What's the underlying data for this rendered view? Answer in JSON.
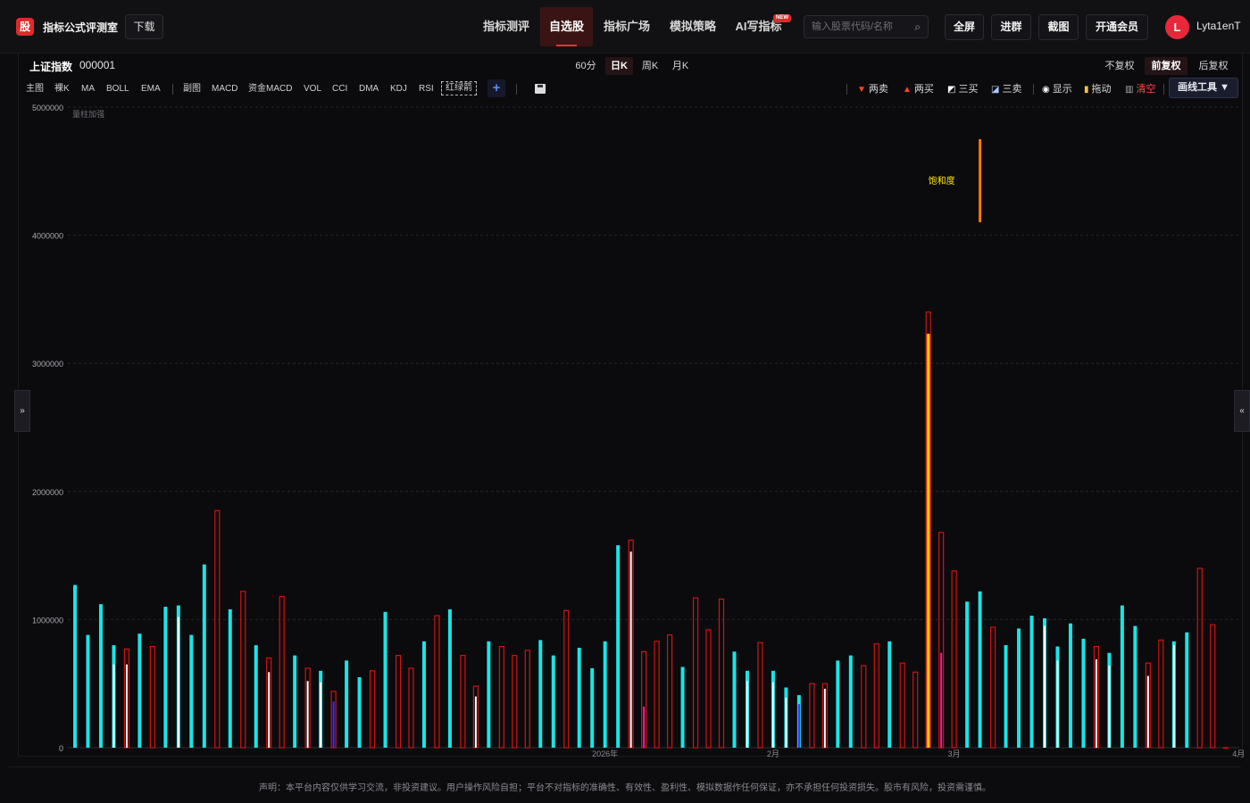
{
  "header": {
    "logo_char": "股",
    "app_title": "指标公式评测室",
    "download": "下载",
    "nav": [
      "指标测评",
      "自选股",
      "指标广场",
      "模拟策略",
      "AI写指标"
    ],
    "nav_active": 1,
    "new_badge": "NEW",
    "search_placeholder": "输入股票代码/名称",
    "search_icon": "⌕",
    "buttons": [
      "全屏",
      "进群",
      "截图",
      "开通会员"
    ],
    "avatar_letter": "L",
    "username": "Lyta1enT"
  },
  "stock": {
    "name": "上证指数",
    "code": "000001"
  },
  "periods": {
    "items": [
      "60分",
      "日K",
      "周K",
      "月K"
    ],
    "active": 1
  },
  "adjust": {
    "items": [
      "不复权",
      "前复权",
      "后复权"
    ],
    "active": 1
  },
  "indicators": {
    "main": [
      "主图",
      "裸K",
      "MA",
      "BOLL",
      "EMA"
    ],
    "sub": [
      "副图",
      "MACD",
      "资金MACD",
      "VOL",
      "CCI",
      "DMA",
      "KDJ",
      "RSI",
      "红绿箭"
    ],
    "add": "+"
  },
  "tools": {
    "two_sell": "两卖",
    "two_buy": "两买",
    "three_buy": "三买",
    "three_sell": "三卖",
    "show": "显示",
    "drag": "拖动",
    "clear": "清空",
    "draw_tool": "画线工具 ▼"
  },
  "side": {
    "left": "»",
    "right": "«"
  },
  "footer": "声明：本平台内容仅供学习交流，非投资建议。用户操作风险自担；平台不对指标的准确性、有效性、盈利性、模拟数据作任何保证，亦不承担任何投资损失。股市有风险，投资需谨慎。",
  "colors": {
    "accent": "#e33",
    "cyan": "#18e6e6",
    "red": "#d71010",
    "orange": "#ff7a00",
    "yellow": "#ffd400",
    "pink": "#ff1a9a"
  },
  "chart_data": {
    "type": "bar",
    "series_label": "量柱加强",
    "annotation": "饱和度",
    "ylim": [
      0,
      5000000
    ],
    "yticks": [
      0,
      1000000,
      2000000,
      3000000,
      4000000,
      5000000
    ],
    "xlabels": [
      "2026年",
      "2月",
      "3月",
      "4月"
    ],
    "xlabel_index": [
      41,
      54,
      68,
      90
    ],
    "bars": [
      {
        "v": 1270000,
        "c": "cyan"
      },
      {
        "v": 880000,
        "c": "cyan"
      },
      {
        "v": 1120000,
        "c": "cyan"
      },
      {
        "v": 800000,
        "c": "cyan",
        "in": 650000,
        "ic": "white"
      },
      {
        "v": 770000,
        "c": "red",
        "in": 650000,
        "ic": "white"
      },
      {
        "v": 890000,
        "c": "cyan"
      },
      {
        "v": 790000,
        "c": "red"
      },
      {
        "v": 1100000,
        "c": "cyan"
      },
      {
        "v": 1110000,
        "c": "cyan",
        "in": 1020000,
        "ic": "white"
      },
      {
        "v": 880000,
        "c": "cyan"
      },
      {
        "v": 1430000,
        "c": "cyan"
      },
      {
        "v": 1850000,
        "c": "red"
      },
      {
        "v": 1080000,
        "c": "cyan"
      },
      {
        "v": 1220000,
        "c": "red"
      },
      {
        "v": 800000,
        "c": "cyan"
      },
      {
        "v": 700000,
        "c": "red",
        "in": 590000,
        "ic": "white"
      },
      {
        "v": 1180000,
        "c": "red"
      },
      {
        "v": 720000,
        "c": "cyan"
      },
      {
        "v": 620000,
        "c": "red",
        "in": 520000,
        "ic": "white"
      },
      {
        "v": 600000,
        "c": "cyan",
        "in": 510000,
        "ic": "white"
      },
      {
        "v": 440000,
        "c": "red",
        "in": 360000,
        "ic": "blue"
      },
      {
        "v": 680000,
        "c": "cyan"
      },
      {
        "v": 550000,
        "c": "cyan"
      },
      {
        "v": 600000,
        "c": "red"
      },
      {
        "v": 1060000,
        "c": "cyan"
      },
      {
        "v": 720000,
        "c": "red"
      },
      {
        "v": 620000,
        "c": "red"
      },
      {
        "v": 830000,
        "c": "cyan"
      },
      {
        "v": 1030000,
        "c": "red"
      },
      {
        "v": 1080000,
        "c": "cyan"
      },
      {
        "v": 720000,
        "c": "red"
      },
      {
        "v": 480000,
        "c": "red",
        "in": 400000,
        "ic": "white"
      },
      {
        "v": 830000,
        "c": "cyan"
      },
      {
        "v": 790000,
        "c": "red"
      },
      {
        "v": 720000,
        "c": "red"
      },
      {
        "v": 760000,
        "c": "red"
      },
      {
        "v": 840000,
        "c": "cyan"
      },
      {
        "v": 720000,
        "c": "cyan"
      },
      {
        "v": 1070000,
        "c": "red"
      },
      {
        "v": 780000,
        "c": "cyan"
      },
      {
        "v": 620000,
        "c": "cyan"
      },
      {
        "v": 830000,
        "c": "cyan"
      },
      {
        "v": 1580000,
        "c": "cyan"
      },
      {
        "v": 1620000,
        "c": "red",
        "in": 1530000,
        "ic": "white"
      },
      {
        "v": 750000,
        "c": "red",
        "in": 320000,
        "ic": "pink"
      },
      {
        "v": 830000,
        "c": "red"
      },
      {
        "v": 880000,
        "c": "red"
      },
      {
        "v": 630000,
        "c": "cyan"
      },
      {
        "v": 1170000,
        "c": "red"
      },
      {
        "v": 920000,
        "c": "red"
      },
      {
        "v": 1160000,
        "c": "red"
      },
      {
        "v": 750000,
        "c": "cyan"
      },
      {
        "v": 600000,
        "c": "cyan",
        "in": 520000,
        "ic": "white"
      },
      {
        "v": 820000,
        "c": "red"
      },
      {
        "v": 600000,
        "c": "cyan",
        "in": 510000,
        "ic": "white"
      },
      {
        "v": 470000,
        "c": "cyan",
        "in": 390000,
        "ic": "white"
      },
      {
        "v": 410000,
        "c": "cyan",
        "in": 340000,
        "ic": "blue"
      },
      {
        "v": 500000,
        "c": "red"
      },
      {
        "v": 500000,
        "c": "red",
        "in": 460000,
        "ic": "white"
      },
      {
        "v": 680000,
        "c": "cyan"
      },
      {
        "v": 720000,
        "c": "cyan"
      },
      {
        "v": 640000,
        "c": "red"
      },
      {
        "v": 810000,
        "c": "red"
      },
      {
        "v": 830000,
        "c": "cyan"
      },
      {
        "v": 660000,
        "c": "red"
      },
      {
        "v": 590000,
        "c": "red"
      },
      {
        "v": 3400000,
        "c": "red",
        "in": 3230000,
        "ic": "orange"
      },
      {
        "v": 1680000,
        "c": "red",
        "in": 740000,
        "ic": "pink"
      },
      {
        "v": 1380000,
        "c": "red"
      },
      {
        "v": 1140000,
        "c": "cyan"
      },
      {
        "v": 1220000,
        "c": "cyan"
      },
      {
        "v": 940000,
        "c": "red"
      },
      {
        "v": 800000,
        "c": "cyan"
      },
      {
        "v": 930000,
        "c": "cyan"
      },
      {
        "v": 1030000,
        "c": "cyan"
      },
      {
        "v": 1010000,
        "c": "cyan",
        "in": 950000,
        "ic": "white"
      },
      {
        "v": 790000,
        "c": "cyan",
        "in": 680000,
        "ic": "white"
      },
      {
        "v": 970000,
        "c": "cyan"
      },
      {
        "v": 850000,
        "c": "cyan"
      },
      {
        "v": 790000,
        "c": "red",
        "in": 690000,
        "ic": "white"
      },
      {
        "v": 740000,
        "c": "cyan",
        "in": 640000,
        "ic": "white"
      },
      {
        "v": 1110000,
        "c": "cyan"
      },
      {
        "v": 950000,
        "c": "cyan"
      },
      {
        "v": 660000,
        "c": "red",
        "in": 560000,
        "ic": "white"
      },
      {
        "v": 840000,
        "c": "red"
      },
      {
        "v": 830000,
        "c": "cyan",
        "in": 800000,
        "ic": "white"
      },
      {
        "v": 900000,
        "c": "cyan"
      },
      {
        "v": 1400000,
        "c": "red"
      },
      {
        "v": 960000,
        "c": "red"
      },
      {
        "v": 0,
        "c": "red"
      }
    ],
    "floating": {
      "index": 70,
      "from": 4100000,
      "to": 4750000,
      "color": "orange"
    }
  }
}
